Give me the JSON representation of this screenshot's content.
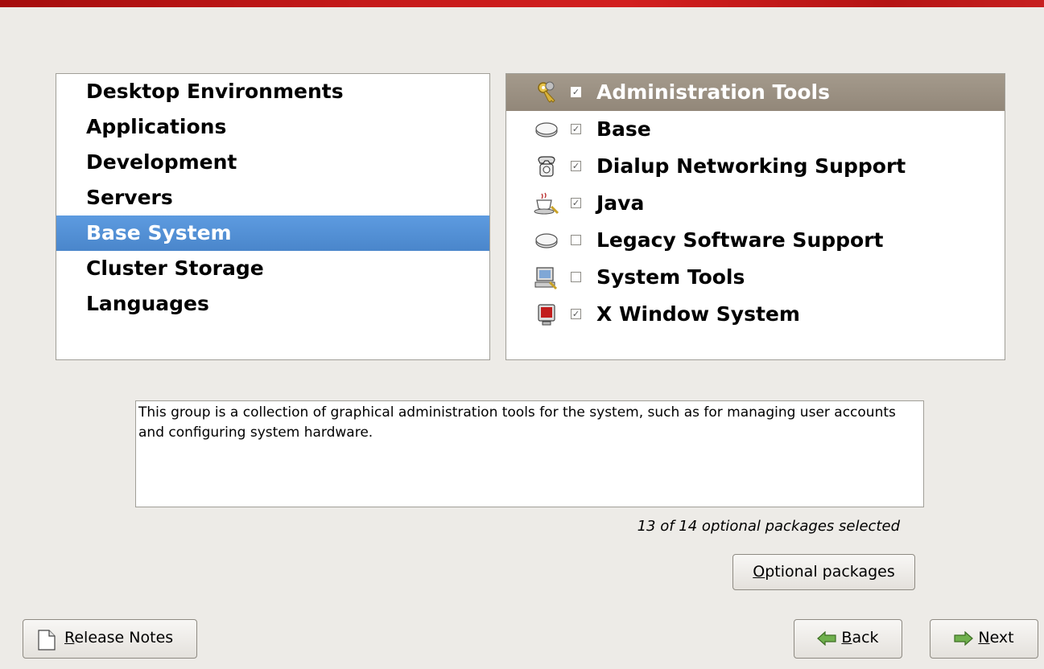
{
  "categories": [
    {
      "label": "Desktop Environments",
      "selected": false
    },
    {
      "label": "Applications",
      "selected": false
    },
    {
      "label": "Development",
      "selected": false
    },
    {
      "label": "Servers",
      "selected": false
    },
    {
      "label": "Base System",
      "selected": true
    },
    {
      "label": "Cluster Storage",
      "selected": false
    },
    {
      "label": "Languages",
      "selected": false
    }
  ],
  "groups": [
    {
      "label": "Administration Tools",
      "checked": true,
      "icon": "keys-icon",
      "selected": true
    },
    {
      "label": "Base",
      "checked": true,
      "icon": "disk-icon",
      "selected": false
    },
    {
      "label": "Dialup Networking Support",
      "checked": true,
      "icon": "phone-icon",
      "selected": false
    },
    {
      "label": "Java",
      "checked": true,
      "icon": "coffee-cup-icon",
      "selected": false
    },
    {
      "label": "Legacy Software Support",
      "checked": false,
      "icon": "disk-icon",
      "selected": false
    },
    {
      "label": "System Tools",
      "checked": false,
      "icon": "computer-icon",
      "selected": false
    },
    {
      "label": "X Window System",
      "checked": true,
      "icon": "monitor-icon",
      "selected": false
    }
  ],
  "description": "This group is a collection of graphical administration tools for the system, such as for managing user accounts and configuring system hardware.",
  "package_count": "13 of 14 optional packages selected",
  "buttons": {
    "optional_packages": {
      "mnemonic": "O",
      "rest": "ptional packages"
    },
    "release_notes": {
      "mnemonic": "R",
      "rest": "elease Notes"
    },
    "back": {
      "mnemonic": "B",
      "rest": "ack"
    },
    "next": {
      "mnemonic": "N",
      "rest": "ext"
    }
  },
  "colors": {
    "banner": "#c51a1a",
    "selection_category": "#4a86cb",
    "selection_group": "#968b7d"
  }
}
